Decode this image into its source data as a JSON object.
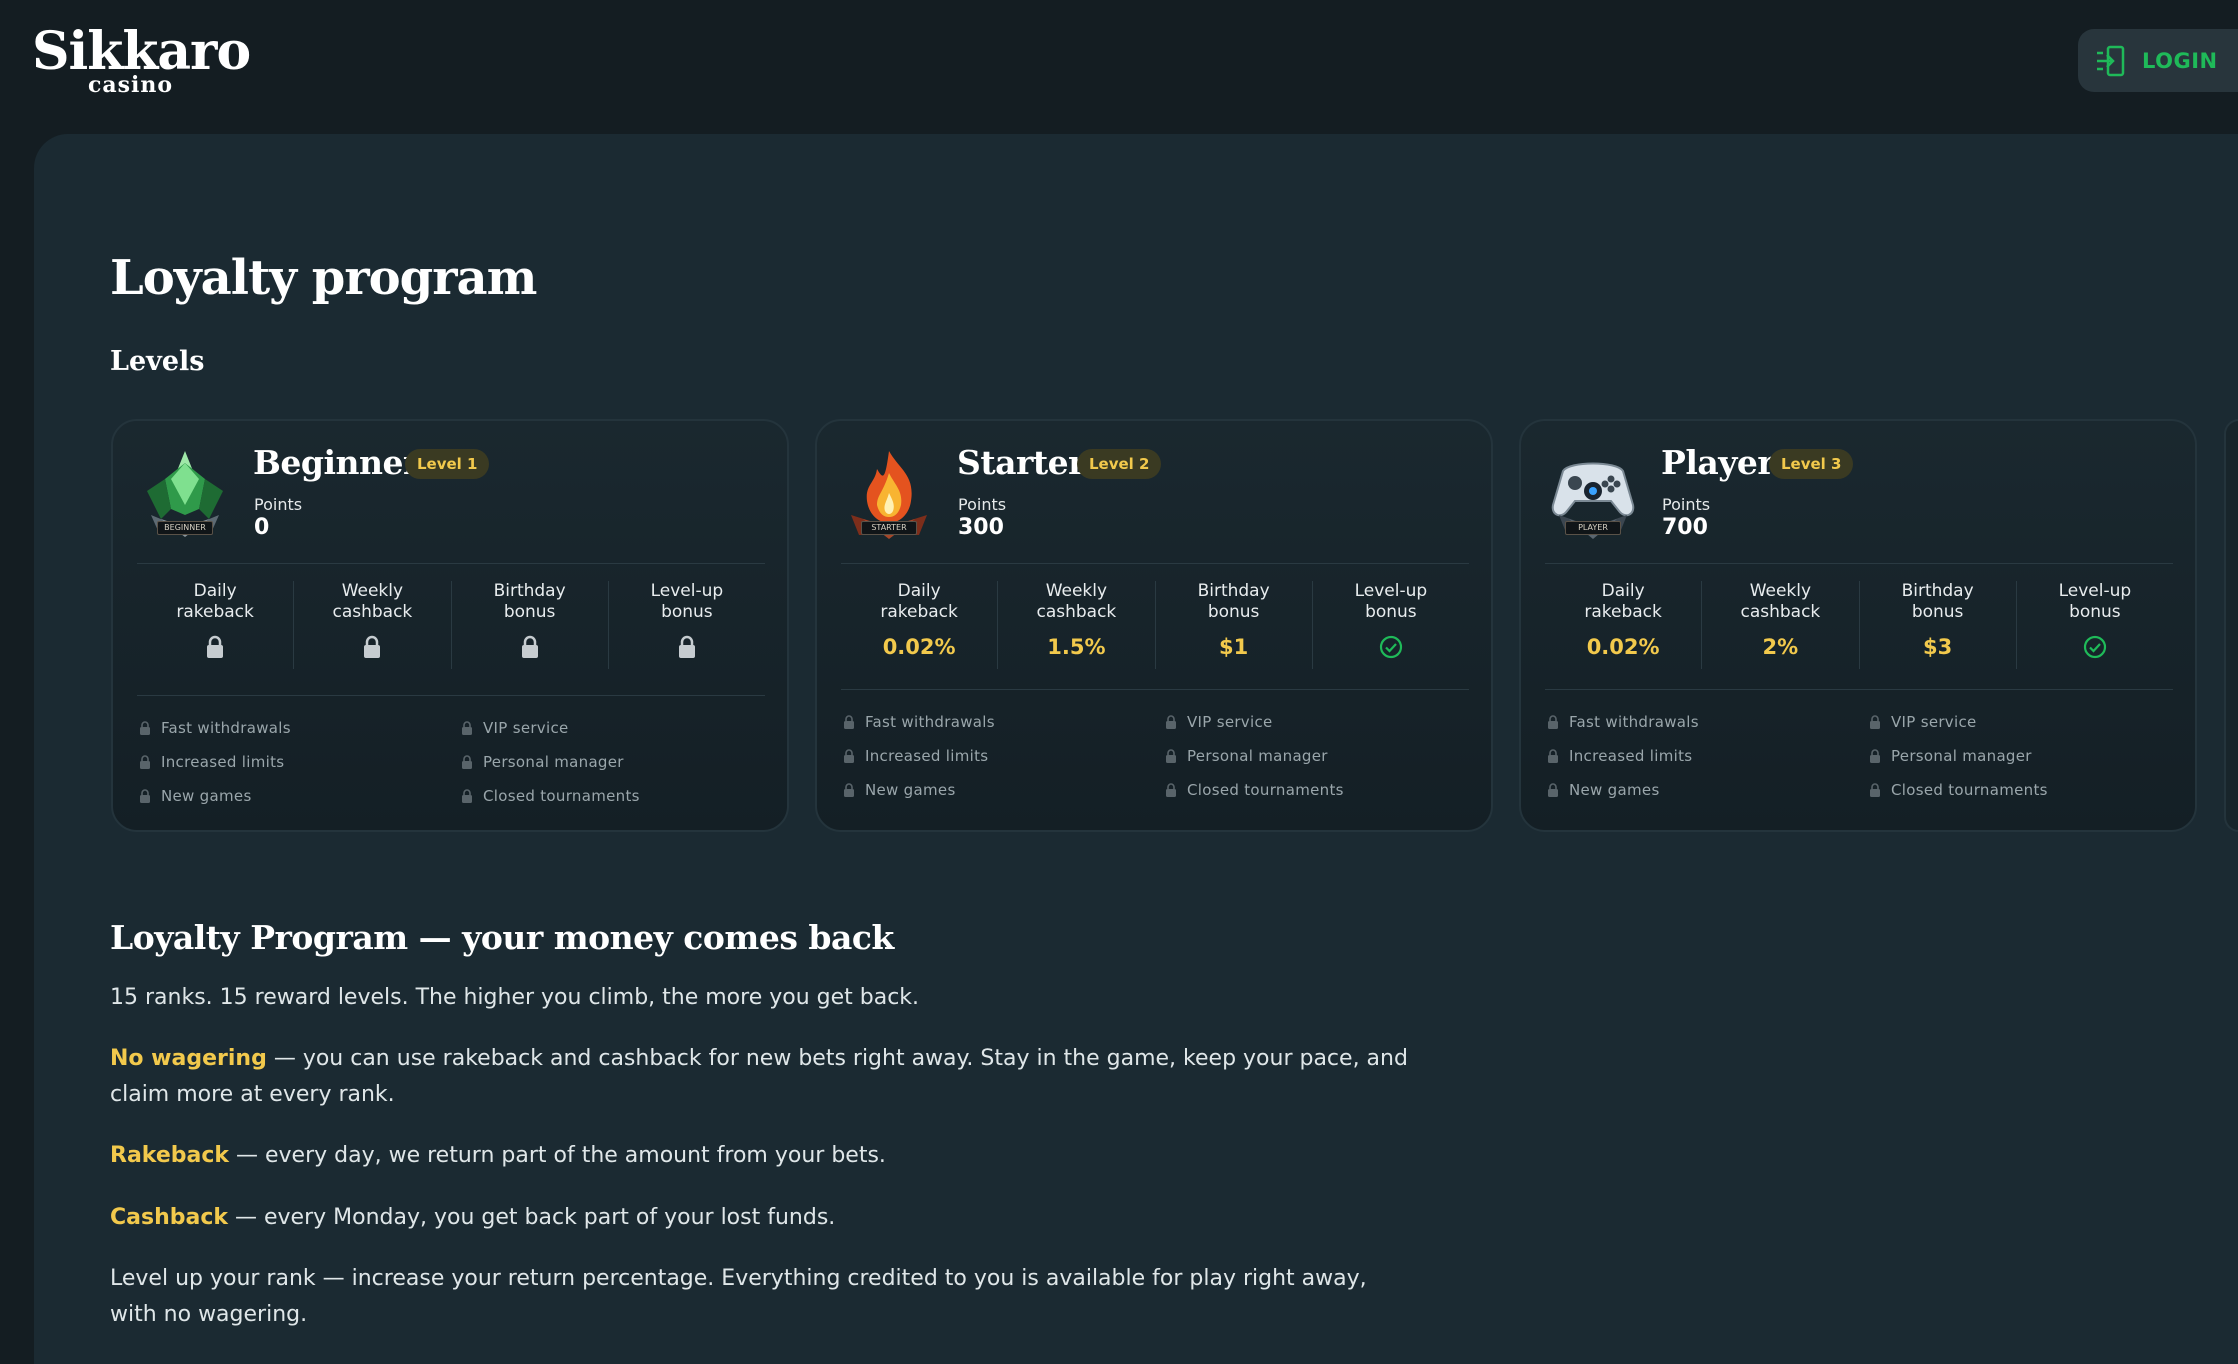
{
  "header": {
    "logo_main": "Sikkaro",
    "logo_sub": "casino",
    "login_label": "LOGIN",
    "accent": "#1fba59"
  },
  "page": {
    "title": "Loyalty program",
    "levels_heading": "Levels"
  },
  "stat_labels": [
    "Daily rakeback",
    "Weekly cashback",
    "Birthday bonus",
    "Level-up bonus"
  ],
  "perk_labels": [
    "Fast withdrawals",
    "VIP service",
    "Increased limits",
    "Personal manager",
    "New games",
    "Closed tournaments"
  ],
  "levels": [
    {
      "name": "Beginner",
      "level": "Level 1",
      "badge_caption": "BEGINNER",
      "points_label": "Points",
      "points": "0",
      "daily_rakeback": "",
      "weekly_cashback": "",
      "birthday_bonus": "",
      "stat_state": "locked",
      "icon": "emerald-crown-badge"
    },
    {
      "name": "Starter",
      "level": "Level 2",
      "badge_caption": "STARTER",
      "points_label": "Points",
      "points": "300",
      "daily_rakeback": "0.02%",
      "weekly_cashback": "1.5%",
      "birthday_bonus": "$1",
      "stat_state": "unlocked",
      "icon": "fire-badge"
    },
    {
      "name": "Player",
      "level": "Level 3",
      "badge_caption": "PLAYER",
      "points_label": "Points",
      "points": "700",
      "daily_rakeback": "0.02%",
      "weekly_cashback": "2%",
      "birthday_bonus": "$3",
      "stat_state": "unlocked",
      "icon": "gamepad-badge"
    }
  ],
  "content": {
    "heading": "Loyalty Program — your money comes back",
    "intro": "15 ranks. 15 reward levels. The higher you climb, the more you get back.",
    "no_wagering_term": "No wagering",
    "no_wagering_text": " — you can use rakeback and cashback for new bets right away. Stay in the game, keep your pace, and claim more at every rank.",
    "rakeback_term": "Rakeback",
    "rakeback_text": " — every day, we return part of the amount from your bets.",
    "cashback_term": "Cashback",
    "cashback_text": " — every Monday, you get back part of your lost funds.",
    "level_up_text": "Level up your rank — increase your return percentage. Everything credited to you is available for play right away, with no wagering."
  },
  "colors": {
    "highlight": "#f2c94c",
    "success": "#1fba59",
    "panel": "#1b2a32",
    "background": "#141d22"
  }
}
